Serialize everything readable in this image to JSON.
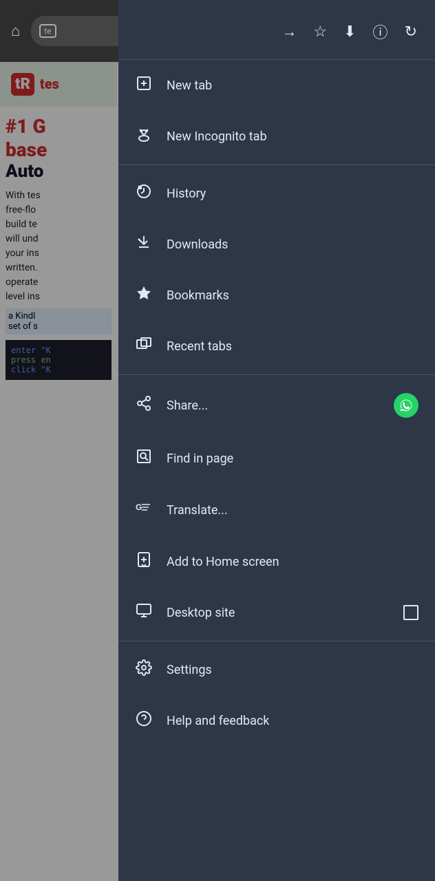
{
  "browser": {
    "home_icon": "⌂",
    "tabs_label": "te",
    "address_text": "te",
    "forward_icon": "→",
    "bookmark_icon": "☆",
    "download_icon": "⬇",
    "info_icon": "ⓘ",
    "refresh_icon": "↻"
  },
  "webpage": {
    "brand": "tR",
    "brand_text": "tes",
    "heading1": "#1 G",
    "heading2": "base",
    "heading3": "Auto",
    "body_text": "With tes free-flo build te will und your ins written. operate level ins",
    "highlight": "a Kindl set of s",
    "code_line1": "enter \"K",
    "code_line2": "press en",
    "code_line3": "click \"K"
  },
  "dropdown": {
    "toolbar": {
      "forward_icon": "→",
      "bookmark_icon": "☆",
      "download_icon": "⬇",
      "info_icon": "ⓘ",
      "refresh_icon": "↻"
    },
    "menu_items": [
      {
        "id": "new-tab",
        "icon": "⊞",
        "label": "New tab",
        "badge": null,
        "checkbox": false
      },
      {
        "id": "new-incognito-tab",
        "icon": "🕵",
        "label": "New Incognito tab",
        "badge": null,
        "checkbox": false
      },
      {
        "id": "history",
        "icon": "⏱",
        "label": "History",
        "badge": null,
        "checkbox": false
      },
      {
        "id": "downloads",
        "icon": "✓⬇",
        "label": "Downloads",
        "badge": null,
        "checkbox": false
      },
      {
        "id": "bookmarks",
        "icon": "★",
        "label": "Bookmarks",
        "badge": null,
        "checkbox": false
      },
      {
        "id": "recent-tabs",
        "icon": "⬜",
        "label": "Recent tabs",
        "badge": null,
        "checkbox": false
      },
      {
        "id": "share",
        "icon": "↗",
        "label": "Share...",
        "badge": "whatsapp",
        "checkbox": false
      },
      {
        "id": "find-in-page",
        "icon": "🔍",
        "label": "Find in page",
        "badge": null,
        "checkbox": false
      },
      {
        "id": "translate",
        "icon": "G≡",
        "label": "Translate...",
        "badge": null,
        "checkbox": false
      },
      {
        "id": "add-to-home",
        "icon": "⊡",
        "label": "Add to Home screen",
        "badge": null,
        "checkbox": false
      },
      {
        "id": "desktop-site",
        "icon": "🖥",
        "label": "Desktop site",
        "badge": null,
        "checkbox": true
      },
      {
        "id": "settings",
        "icon": "⚙",
        "label": "Settings",
        "badge": null,
        "checkbox": false
      },
      {
        "id": "help-feedback",
        "icon": "?",
        "label": "Help and feedback",
        "badge": null,
        "checkbox": false
      }
    ],
    "dividers_after": [
      "new-incognito-tab",
      "recent-tabs",
      "desktop-site"
    ]
  }
}
